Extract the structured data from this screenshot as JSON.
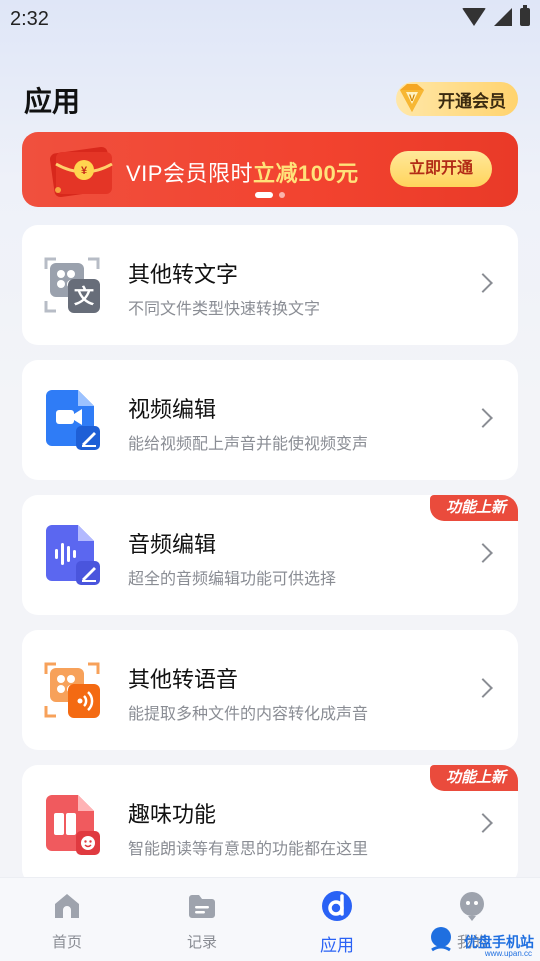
{
  "status_bar": {
    "time": "2:32"
  },
  "header": {
    "title": "应用",
    "vip_button": "开通会员"
  },
  "banner": {
    "text_prefix": "VIP会员限时",
    "text_highlight": "立减100元",
    "cta": "立即开通"
  },
  "cards": [
    {
      "title": "其他转文字",
      "desc": "不同文件类型快速转换文字",
      "icon": "file-to-text-icon",
      "badge": ""
    },
    {
      "title": "视频编辑",
      "desc": "能给视频配上声音并能使视频变声",
      "icon": "video-edit-icon",
      "badge": ""
    },
    {
      "title": "音频编辑",
      "desc": "超全的音频编辑功能可供选择",
      "icon": "audio-edit-icon",
      "badge": "功能上新"
    },
    {
      "title": "其他转语音",
      "desc": "能提取多种文件的内容转化成声音",
      "icon": "file-to-voice-icon",
      "badge": ""
    },
    {
      "title": "趣味功能",
      "desc": "智能朗读等有意思的功能都在这里",
      "icon": "fun-icon",
      "badge": "功能上新"
    }
  ],
  "nav": [
    {
      "label": "首页",
      "icon": "home-icon",
      "active": false
    },
    {
      "label": "记录",
      "icon": "folder-icon",
      "active": false
    },
    {
      "label": "应用",
      "icon": "apps-icon",
      "active": true
    },
    {
      "label": "我的",
      "icon": "profile-icon",
      "active": false
    }
  ],
  "watermark": {
    "text": "优盘手机站",
    "sub": "www.upan.cc"
  },
  "colors": {
    "accent": "#2a62f5",
    "banner": "#f2432f",
    "badge": "#ea4b3c"
  }
}
